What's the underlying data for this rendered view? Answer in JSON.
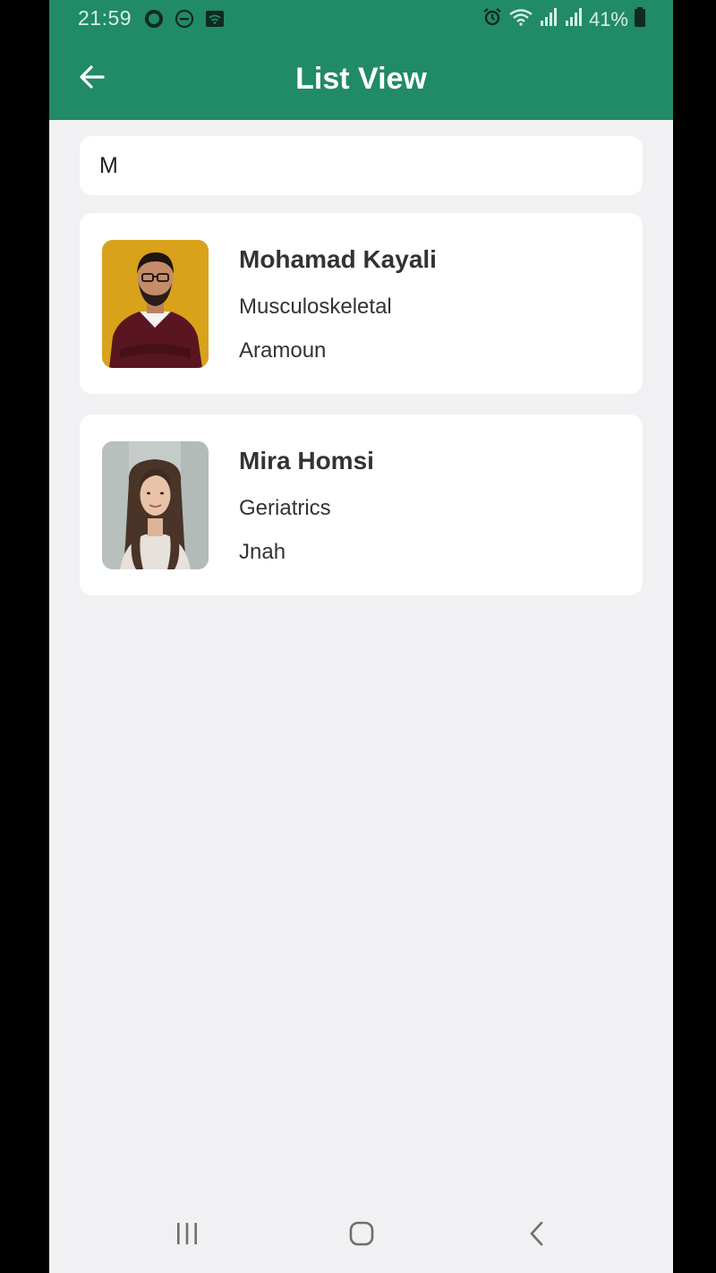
{
  "status_bar": {
    "time": "21:59",
    "battery_percent": "41%",
    "icons": [
      "circle-notification-icon",
      "do-not-disturb-icon",
      "wifi-calling-icon",
      "alarm-icon",
      "wifi-icon",
      "signal-icon",
      "signal-icon",
      "battery-icon"
    ]
  },
  "app_bar": {
    "title": "List View",
    "back_icon": "arrow-left-icon"
  },
  "search": {
    "value": "M"
  },
  "results": [
    {
      "name": "Mohamad Kayali",
      "specialty": "Musculoskeletal",
      "location": "Aramoun"
    },
    {
      "name": "Mira Homsi",
      "specialty": "Geriatrics",
      "location": "Jnah"
    }
  ],
  "colors": {
    "primary": "#218A67",
    "background": "#F1F0F2",
    "card": "#FFFFFF",
    "text": "#333333"
  },
  "nav_bar": {
    "icons": [
      "recents-icon",
      "home-icon",
      "back-icon"
    ]
  }
}
